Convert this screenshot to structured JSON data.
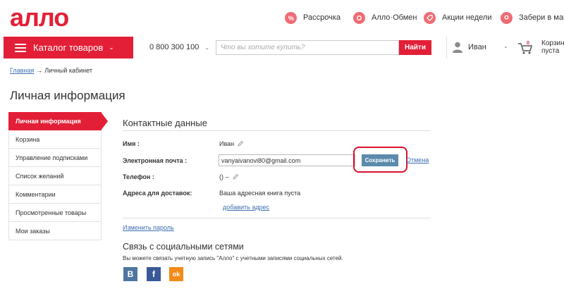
{
  "brand": {
    "logo_text": "алло",
    "accent": "#e31f37"
  },
  "top_links": [
    {
      "label": "Рассрочка",
      "icon": "percent-icon"
    },
    {
      "label": "Алло·Обмен",
      "icon": "exchange-icon"
    },
    {
      "label": "Акции недели",
      "icon": "sale-icon"
    },
    {
      "label": "Забери в магази",
      "icon": "location-pin-icon"
    }
  ],
  "header": {
    "catalog_label": "Каталог товаров",
    "phone": "0 800 300 100",
    "search_placeholder": "Что вы хотите купить?",
    "search_button": "Найти",
    "user_name": "Иван",
    "cart_line1": "Корзина",
    "cart_line2": "пуста"
  },
  "breadcrumb": {
    "home": "Главная",
    "arrow": "→",
    "current": "Личный кабинет"
  },
  "page_title": "Личная информация",
  "sidebar": [
    {
      "label": "Личная информация",
      "active": true
    },
    {
      "label": "Корзина"
    },
    {
      "label": "Управление подписками"
    },
    {
      "label": "Список желаний"
    },
    {
      "label": "Комментарии"
    },
    {
      "label": "Просмотренные товары"
    },
    {
      "label": "Мои заказы"
    }
  ],
  "contacts": {
    "title": "Контактные данные",
    "name_label": "Имя :",
    "name_value": "Иван",
    "email_label": "Электронная почта :",
    "email_value": "vanyaivanovi80@gmail.com",
    "save_button": "Сохранить",
    "cancel_link": "Отмена",
    "phone_label": "Телефон :",
    "phone_value": "() –",
    "address_label": "Адреса для доставок:",
    "address_value": "Ваша адресная книга пуста",
    "add_address_link": "добавить адрес",
    "change_password_link": "Изменить пароль"
  },
  "social": {
    "title": "Связь с социальными сетями",
    "description": "Вы можете связать учетную запись \"Алло\" с учетными записями социальных сетей.",
    "networks": [
      {
        "glyph": "В",
        "icon": "vk-icon",
        "color": "#4e76a1"
      },
      {
        "glyph": "f",
        "icon": "facebook-icon",
        "color": "#3b5998"
      },
      {
        "glyph": "ok",
        "icon": "odnoklassniki-icon",
        "color": "#f28a1a"
      }
    ]
  }
}
